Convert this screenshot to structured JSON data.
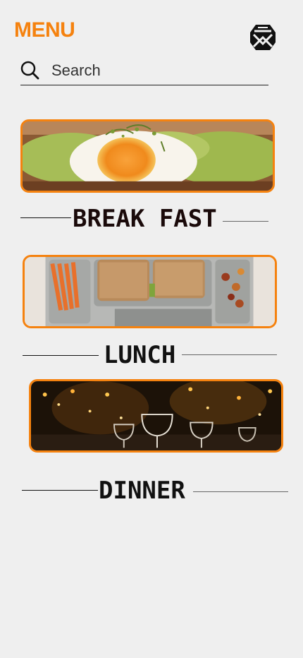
{
  "header": {
    "title": "MENU",
    "logo_icon": "geometric-face-logo-icon"
  },
  "search": {
    "placeholder": "Search",
    "icon": "search-icon"
  },
  "sections": [
    {
      "label": "BREAK FAST",
      "image": "avocado toast with boiled egg"
    },
    {
      "label": "LUNCH",
      "image": "sandwich tray lunch"
    },
    {
      "label": "DINNER",
      "image": "wine glasses restaurant at night"
    }
  ],
  "colors": {
    "accent": "#f5820f",
    "background": "#efefef",
    "text": "#111111"
  }
}
